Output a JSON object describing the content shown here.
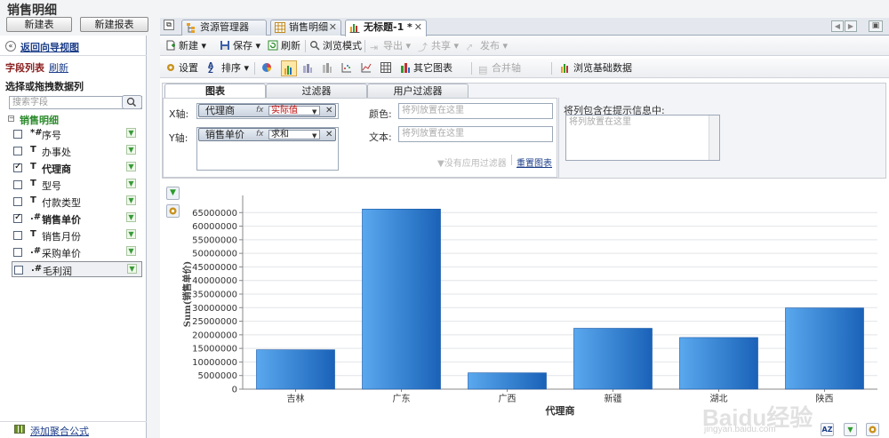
{
  "app": {
    "title": "销售明细",
    "new_table": "新建表",
    "new_report": "新建报表"
  },
  "sidebar": {
    "back_link": "返回向导视图",
    "field_list_label": "字段列表",
    "refresh_link": "刷新",
    "choose_label": "选择或拖拽数据列",
    "search_placeholder": "搜索字段",
    "group_name": "销售明细",
    "fields": [
      {
        "type": "*#",
        "name": "序号",
        "checked": false,
        "bold": false
      },
      {
        "type": "T",
        "name": "办事处",
        "checked": false,
        "bold": false
      },
      {
        "type": "T",
        "name": "代理商",
        "checked": true,
        "bold": true
      },
      {
        "type": "T",
        "name": "型号",
        "checked": false,
        "bold": false
      },
      {
        "type": "T",
        "name": "付款类型",
        "checked": false,
        "bold": false
      },
      {
        "type": ".#",
        "name": "销售单价",
        "checked": true,
        "bold": true
      },
      {
        "type": "T",
        "name": "销售月份",
        "checked": false,
        "bold": false
      },
      {
        "type": ".#",
        "name": "采购单价",
        "checked": false,
        "bold": false
      },
      {
        "type": ".#",
        "name": "毛利润",
        "checked": false,
        "bold": false
      }
    ],
    "add_formula": "添加聚合公式"
  },
  "tabs": [
    {
      "label": "资源管理器",
      "closable": false,
      "active": false
    },
    {
      "label": "销售明细",
      "closable": true,
      "active": false
    },
    {
      "label": "无标题-1 *",
      "closable": true,
      "active": true
    }
  ],
  "toolbar1": {
    "new": "新建",
    "save": "保存",
    "refresh": "刷新",
    "browse_mode": "浏览模式",
    "export": "导出",
    "share": "共享",
    "publish": "发布"
  },
  "toolbar2": {
    "settings": "设置",
    "sort": "排序",
    "other_charts": "其它图表",
    "merge_axis": "合并轴",
    "browse_data": "浏览基础数据"
  },
  "panel": {
    "tabs": [
      "图表",
      "过滤器",
      "用户过滤器"
    ],
    "x_label": "X轴:",
    "y_label": "Y轴:",
    "x_field": "代理商",
    "x_func": "实际值",
    "y_field": "销售单价",
    "y_func": "求和",
    "fx": "fx",
    "color_label": "颜色:",
    "text_label": "文本:",
    "drop_placeholder": "将列放置在这里",
    "no_filter": "没有应用过滤器",
    "reset_chart": "重置图表",
    "tooltip_label": "将列包含在提示信息中:"
  },
  "colors": {
    "bar_light": "#5aa8ee",
    "bar_dark": "#1a62b8",
    "accent": "#1d3f8a"
  },
  "chart_data": {
    "type": "bar",
    "categories": [
      "吉林",
      "广东",
      "广西",
      "新疆",
      "湖北",
      "陕西"
    ],
    "values": [
      14500000,
      66300000,
      6000000,
      22400000,
      19000000,
      29900000
    ],
    "xlabel": "代理商",
    "ylabel": "Sum(销售单价)",
    "ylim": [
      0,
      70000000
    ],
    "yticks": [
      0,
      5000000,
      10000000,
      15000000,
      20000000,
      25000000,
      30000000,
      35000000,
      40000000,
      45000000,
      50000000,
      55000000,
      60000000,
      65000000
    ],
    "grid": true
  },
  "watermark": {
    "brand": "Baidu经验",
    "url": "jingyan.baidu.com"
  }
}
